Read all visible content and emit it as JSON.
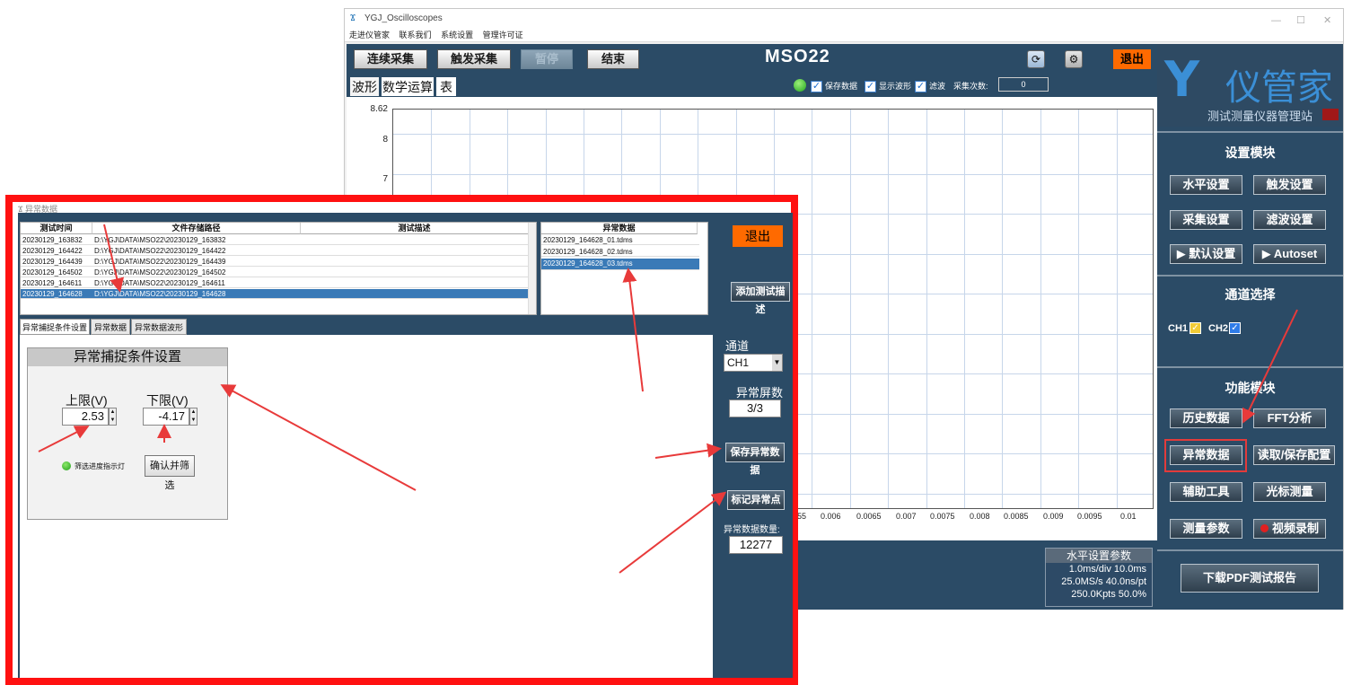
{
  "window": {
    "title": "YGJ_Oscilloscopes",
    "controls": [
      "—",
      "☐",
      "✕"
    ]
  },
  "menu": [
    "走进仪管家",
    "联系我们",
    "系统设置",
    "管理许可证"
  ],
  "toolbar": {
    "btn_continuous": "连续采集",
    "btn_trigger": "触发采集",
    "btn_pause": "暂停",
    "btn_end": "结束",
    "device": "MSO22",
    "exit": "退出"
  },
  "wave_tabs": [
    "波形",
    "数学运算",
    "表"
  ],
  "options": {
    "save_data": "保存数据",
    "show_wave": "显示波形",
    "filter": "滤波",
    "count_label": "采集次数:",
    "count_value": "0"
  },
  "plot": {
    "y_ticks": [
      "8.62",
      "8",
      "7"
    ],
    "x_ticks": [
      "55",
      "0.006",
      "0.0065",
      "0.007",
      "0.0075",
      "0.008",
      "0.0085",
      "0.009",
      "0.0095",
      "0.01"
    ]
  },
  "hparams": {
    "title": "水平设置参数",
    "row1": "1.0ms/div   10.0ms",
    "row2": "25.0MS/s   40.0ns/pt",
    "row3": "250.0Kpts      50.0%"
  },
  "logo": {
    "title": "仪管家",
    "subtitle": "测试测量仪器管理站"
  },
  "settings": {
    "title": "设置模块",
    "horizontal": "水平设置",
    "trigger": "触发设置",
    "acquire": "采集设置",
    "filter": "滤波设置",
    "default": "▶ 默认设置",
    "autoset": "▶ Autoset"
  },
  "channels": {
    "title": "通道选择",
    "ch1": "CH1",
    "ch2": "CH2"
  },
  "functions": {
    "title": "功能模块",
    "history": "历史数据",
    "fft": "FFT分析",
    "anomaly": "异常数据",
    "rwconfig": "读取/保存配置",
    "tools": "辅助工具",
    "cursor": "光标测量",
    "measure": "测量参数",
    "record": "视频录制"
  },
  "pdf_button": "下载PDF测试报告",
  "dialog": {
    "title": "异常数据",
    "exit": "退出",
    "headers": {
      "time": "测试时间",
      "path": "文件存储路径",
      "desc": "测试描述",
      "anomaly": "异常数据"
    },
    "rows": [
      {
        "time": "20230129_163832",
        "path": "D:\\YGJ\\DATA\\MSO22\\20230129_163832"
      },
      {
        "time": "20230129_164422",
        "path": "D:\\YGJ\\DATA\\MSO22\\20230129_164422"
      },
      {
        "time": "20230129_164439",
        "path": "D:\\YGJ\\DATA\\MSO22\\20230129_164439"
      },
      {
        "time": "20230129_164502",
        "path": "D:\\YGJ\\DATA\\MSO22\\20230129_164502"
      },
      {
        "time": "20230129_164611",
        "path": "D:\\YGJ\\DATA\\MSO22\\20230129_164611"
      },
      {
        "time": "20230129_164628",
        "path": "D:\\YGJ\\DATA\\MSO22\\20230129_164628"
      }
    ],
    "anomaly_files": [
      "20230129_164628_01.tdms",
      "20230129_164628_02.tdms",
      "20230129_164628_03.tdms"
    ],
    "add_desc": "添加测试描述",
    "tabs": [
      "异常捕捉条件设置",
      "异常数据",
      "异常数据波形"
    ],
    "cond": {
      "title": "异常捕捉条件设置",
      "upper_label": "上限(V)",
      "upper_value": "2.53",
      "lower_label": "下限(V)",
      "lower_value": "-4.17",
      "progress_label": "筛选进度指示灯",
      "confirm": "确认并筛选"
    },
    "side": {
      "channel_label": "通道",
      "channel_value": "CH1",
      "screens_label": "异常屏数",
      "screens_value": "3/3",
      "save": "保存异常数据",
      "mark": "标记异常点",
      "count_label": "异常数据数量:",
      "count_value": "12277"
    }
  }
}
